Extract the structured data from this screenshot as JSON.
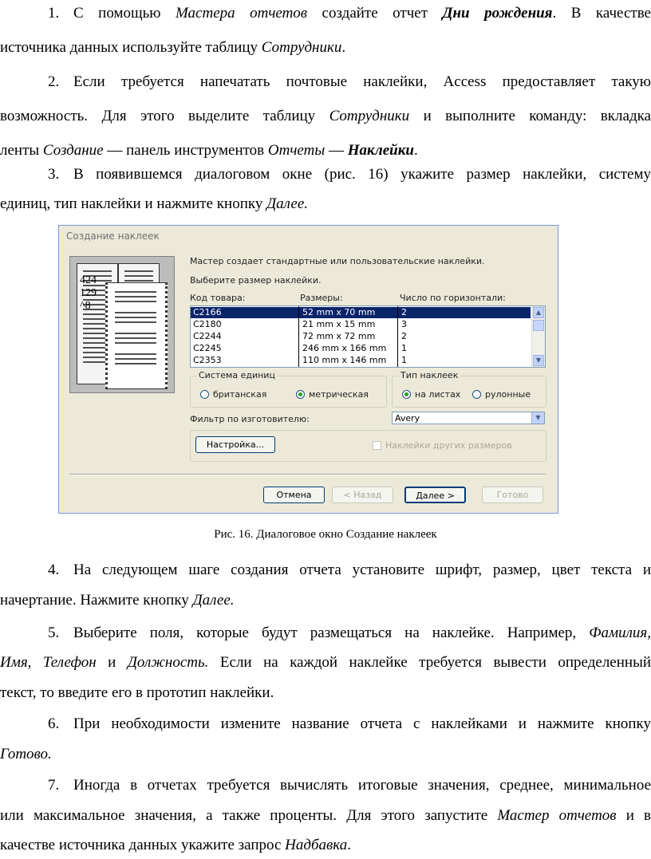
{
  "paragraphs": {
    "p1": {
      "num": "1.",
      "l1": [
        "С помощью ",
        "Мастера отчетов",
        " создайте отчет ",
        "Дни рождения",
        ". В качестве"
      ],
      "l2": [
        "источника данных используйте таблицу ",
        "Сотрудники",
        "."
      ]
    },
    "p2": {
      "num": "2.",
      "l1": "Если требуется напечатать почтовые наклейки, Access предоставляет такую",
      "l2": [
        "возможность. Для этого выделите таблицу ",
        "Сотрудники",
        " и выполните команду: вкладка"
      ],
      "l3": [
        "ленты ",
        "Создание",
        " — панель инструментов ",
        "Отчеты",
        " — ",
        "Наклейки",
        "."
      ]
    },
    "p3": {
      "num": "3.",
      "l1": "В появившемся диалоговом окне (рис. 16) укажите размер наклейки, систему",
      "l2": [
        "единиц, тип наклейки и нажмите кнопку ",
        "Далее."
      ]
    },
    "p4": {
      "num": "4.",
      "l1": "На следующем шаге создания отчета установите шрифт, размер, цвет текста и",
      "l2": [
        "начертание. Нажмите кнопку ",
        "Далее."
      ]
    },
    "p5": {
      "num": "5.",
      "l1": [
        "Выберите поля, которые будут размещаться на наклейке. Например, ",
        "Фамилия,"
      ],
      "l2": [
        "Имя, Телефон",
        " и ",
        "Должность.",
        " Если на каждой наклейке требуется вывести определенный"
      ],
      "l3": "текст, то введите его в прототип наклейки."
    },
    "p6": {
      "num": "6.",
      "l1": "При необходимости измените название отчета с наклейками и нажмите кнопку",
      "l2": "Готово."
    },
    "p7": {
      "num": "7.",
      "l1": "Иногда в отчетах требуется вычислять итоговые значения, среднее, минимальное",
      "l2": [
        "или максимальное значения, а также проценты. Для этого запустите ",
        "Мастер отчетов",
        " и в"
      ],
      "l3": [
        "качестве источника данных укажите запрос ",
        "Надбавка",
        "."
      ]
    }
  },
  "dialog": {
    "title": "Создание наклеек",
    "preview_numbers": [
      "424",
      "129",
      "^8"
    ],
    "intro_line1": "Мастер создает стандартные или пользовательские наклейки.",
    "intro_line2": "Выберите размер наклейки.",
    "columns": [
      "Код товара:",
      "Размеры:",
      "Число по горизонтали:"
    ],
    "rows": [
      {
        "code": "C2166",
        "size": "52 mm x 70 mm",
        "count": "2"
      },
      {
        "code": "C2180",
        "size": "21 mm x 15 mm",
        "count": "3"
      },
      {
        "code": "C2244",
        "size": "72 mm x 72 mm",
        "count": "2"
      },
      {
        "code": "C2245",
        "size": "246 mm x 166 mm",
        "count": "1"
      },
      {
        "code": "C2353",
        "size": "110 mm x 146 mm",
        "count": "1"
      }
    ],
    "units_group": "Система единиц",
    "units_options": [
      "британская",
      "метрическая"
    ],
    "units_selected": "метрическая",
    "type_group": "Тип наклеек",
    "type_options": [
      "на листах",
      "рулонные"
    ],
    "type_selected": "на листах",
    "filter_label": "Фильтр по изготовителю:",
    "filter_value": "Avery",
    "customize_button": "Настройка...",
    "other_sizes_checkbox": "Наклейки других размеров",
    "buttons": {
      "cancel": "Отмена",
      "back": "< Назад",
      "next": "Далее >",
      "finish": "Готово"
    }
  },
  "caption": "Рис. 16. Диалоговое окно Создание наклеек"
}
